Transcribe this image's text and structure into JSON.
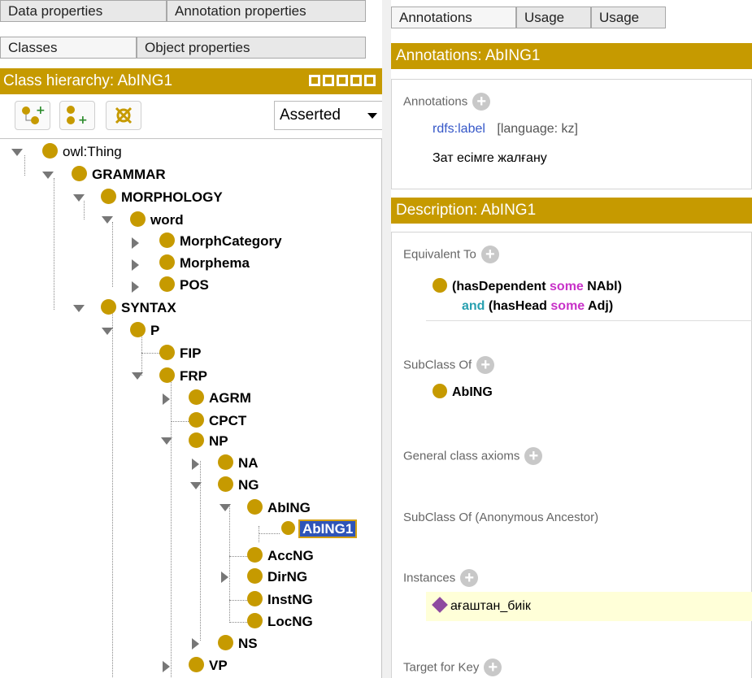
{
  "left_tabs": {
    "row1": [
      "Data properties",
      "Annotation properties"
    ],
    "row2": [
      "Classes",
      "Object properties"
    ]
  },
  "hierarchy": {
    "title": "Class hierarchy: AbING1",
    "mode": "Asserted"
  },
  "tree": [
    {
      "label": "owl:Thing",
      "bold": false
    },
    {
      "label": "GRAMMAR",
      "bold": true
    },
    {
      "label": "MORPHOLOGY",
      "bold": true
    },
    {
      "label": "word",
      "bold": true
    },
    {
      "label": "MorphCategory",
      "bold": true
    },
    {
      "label": "Morphema",
      "bold": true
    },
    {
      "label": "POS",
      "bold": true
    },
    {
      "label": "SYNTAX",
      "bold": true
    },
    {
      "label": "P",
      "bold": true
    },
    {
      "label": "FIP",
      "bold": true
    },
    {
      "label": "FRP",
      "bold": true
    },
    {
      "label": "AGRM",
      "bold": true
    },
    {
      "label": "CPCT",
      "bold": true
    },
    {
      "label": "NP",
      "bold": true
    },
    {
      "label": "NA",
      "bold": true
    },
    {
      "label": "NG",
      "bold": true
    },
    {
      "label": "AbING",
      "bold": true
    },
    {
      "label": "AbING1",
      "bold": true
    },
    {
      "label": "AccNG",
      "bold": true
    },
    {
      "label": "DirNG",
      "bold": true
    },
    {
      "label": "InstNG",
      "bold": true
    },
    {
      "label": "LocNG",
      "bold": true
    },
    {
      "label": "NS",
      "bold": true
    },
    {
      "label": "VP",
      "bold": true
    }
  ],
  "right_tabs": [
    "Annotations",
    "Usage",
    "Usage"
  ],
  "annotations_panel": {
    "title": "Annotations: AbING1",
    "header": "Annotations",
    "property": "rdfs:label",
    "lang": "[language: kz]",
    "value": "Зат есімге жалғану"
  },
  "description_panel": {
    "title": "Description: AbING1",
    "equivalent_header": "Equivalent To",
    "eq_part1": "(hasDependent",
    "eq_some1": "some",
    "eq_part2": "NAbl)",
    "eq_and": "and",
    "eq_part3": "(hasHead",
    "eq_some2": "some",
    "eq_part4": "Adj)",
    "subclass_header": "SubClass Of",
    "subclass_value": "AbING",
    "general_header": "General class axioms",
    "anon_header": "SubClass Of (Anonymous Ancestor)",
    "instances_header": "Instances",
    "instance_value": "ағаштан_биік",
    "target_header": "Target for Key"
  },
  "colors": {
    "accent": "#c69a00",
    "selection": "#2e54b8",
    "keyword": "#c832c8",
    "instance_bg": "#ffffd8"
  }
}
